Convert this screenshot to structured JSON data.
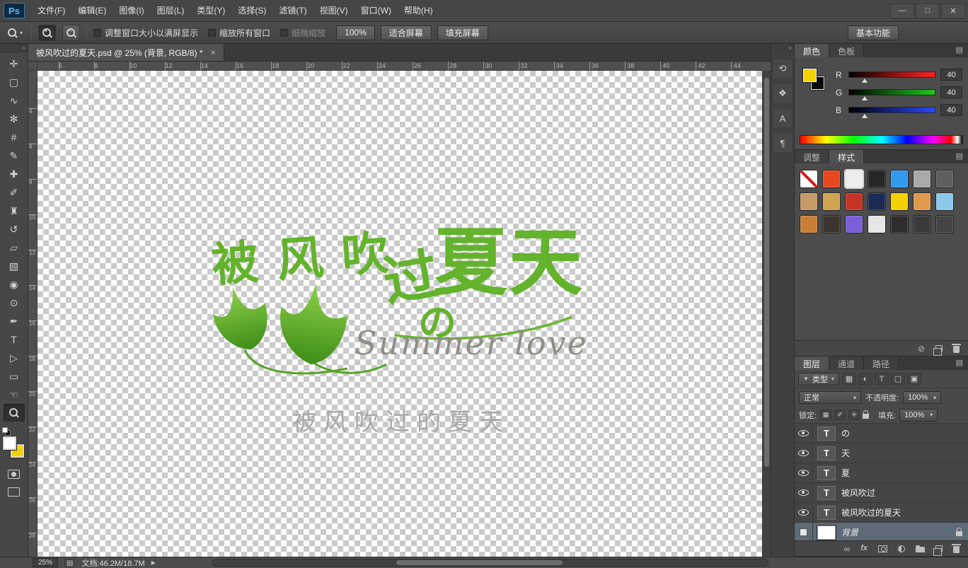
{
  "titlebar": {
    "logo": "Ps",
    "menus": [
      "文件(F)",
      "编辑(E)",
      "图像(I)",
      "图层(L)",
      "类型(Y)",
      "选择(S)",
      "滤镜(T)",
      "视图(V)",
      "窗口(W)",
      "帮助(H)"
    ],
    "window_buttons": [
      {
        "name": "minimize-button",
        "glyph": "—"
      },
      {
        "name": "maximize-button",
        "glyph": "□"
      },
      {
        "name": "close-button",
        "glyph": "✕"
      }
    ]
  },
  "options_bar": {
    "checkboxes": [
      {
        "label": "调整窗口大小以满屏显示",
        "checked": false,
        "disabled": false
      },
      {
        "label": "缩放所有窗口",
        "checked": false,
        "disabled": false
      },
      {
        "label": "细微缩放",
        "checked": false,
        "disabled": true
      }
    ],
    "buttons": [
      "100%",
      "适合屏幕",
      "填充屏幕"
    ],
    "workspace_button": "基本功能"
  },
  "chrome": {
    "collapse_tools": "»",
    "collapse_panels": "«",
    "panel_menu": "▤",
    "tool_preset_dropdown": "▾",
    "status_flyout": "▶",
    "proxy_icon": "▤"
  },
  "document_tab": {
    "title": "被风吹过的夏天.psd @ 25% (背景, RGB/8) *",
    "close": "×"
  },
  "tools": [
    {
      "name": "move-tool",
      "glyph": "✛"
    },
    {
      "name": "rectangular-marquee-tool",
      "glyph": "▢"
    },
    {
      "name": "lasso-tool",
      "glyph": "∿"
    },
    {
      "name": "quick-selection-tool",
      "glyph": "✻"
    },
    {
      "name": "crop-tool",
      "glyph": "#"
    },
    {
      "name": "eyedropper-tool",
      "glyph": "✎"
    },
    {
      "name": "spot-healing-brush-tool",
      "glyph": "✚"
    },
    {
      "name": "brush-tool",
      "glyph": "✐"
    },
    {
      "name": "clone-stamp-tool",
      "glyph": "♜"
    },
    {
      "name": "history-brush-tool",
      "glyph": "↺"
    },
    {
      "name": "eraser-tool",
      "glyph": "▱"
    },
    {
      "name": "gradient-tool",
      "glyph": "▧"
    },
    {
      "name": "blur-tool",
      "glyph": "◉"
    },
    {
      "name": "dodge-tool",
      "glyph": "⊙"
    },
    {
      "name": "pen-tool",
      "glyph": "✒"
    },
    {
      "name": "type-tool",
      "glyph": "T"
    },
    {
      "name": "path-selection-tool",
      "glyph": "▷"
    },
    {
      "name": "rectangle-tool",
      "glyph": "▭"
    },
    {
      "name": "hand-tool",
      "glyph": "☜"
    },
    {
      "name": "zoom-tool",
      "css": "mag",
      "selected": true
    }
  ],
  "ruler": {
    "horizontal": [
      "6",
      "8",
      "10",
      "12",
      "14",
      "16",
      "18",
      "20",
      "22",
      "24",
      "26",
      "28",
      "30",
      "32",
      "34",
      "36",
      "38",
      "40",
      "42",
      "44"
    ],
    "vertical": [
      "4",
      "6",
      "8",
      "10",
      "12",
      "14",
      "16",
      "18",
      "20",
      "22",
      "24",
      "26",
      "28"
    ]
  },
  "artwork": {
    "title_part1": "被风吹",
    "title_part2": "过",
    "title_part3": "夏天",
    "title_part4": "の",
    "subtitle_script": "Summer love",
    "subtitle_gray": "被风吹过的夏天",
    "green": "#63b32c",
    "leaf_dark": "#3e8d18",
    "leaf_light": "#8ed24a",
    "script_gray": "#8f8f86",
    "gray": "#a9a9a9"
  },
  "panel_strip": [
    {
      "name": "history-panel-icon",
      "glyph": "⟲"
    },
    {
      "name": "clone-source-panel-icon",
      "glyph": "❖"
    },
    {
      "name": "character-panel-icon",
      "glyph": "A"
    },
    {
      "name": "paragraph-panel-icon",
      "glyph": "¶"
    }
  ],
  "color_panel": {
    "tabs": [
      "颜色",
      "色板"
    ],
    "active_tab": "颜色",
    "foreground": "#f2d200",
    "background": "#0a0a0a",
    "channels": [
      {
        "label": "R",
        "value": "40",
        "track": "red"
      },
      {
        "label": "G",
        "value": "40",
        "track": "green"
      },
      {
        "label": "B",
        "value": "40",
        "track": "blue"
      }
    ]
  },
  "styles_panel": {
    "tabs": [
      "调整",
      "样式"
    ],
    "active_tab": "样式",
    "swatches": [
      "none",
      "#e8481f",
      "#ededed",
      "#262626",
      "#2f9bf0",
      "#a9a9a9",
      "#5f5f5f",
      "#c59a67",
      "#d2a352",
      "#c63427",
      "#1c2a56",
      "#f3d103",
      "#e09a4e",
      "#8cc8ea",
      "#c87f35",
      "#3c3430",
      "#7a5fd6",
      "#e6e6e6",
      "#2d2d2d",
      "#3a3a3a",
      "#444444"
    ],
    "bottom_icons": [
      {
        "name": "clear-style-icon",
        "glyph": "⊘"
      },
      {
        "name": "new-style-icon",
        "css": "newlayer"
      },
      {
        "name": "delete-style-icon",
        "css": "trash"
      }
    ]
  },
  "layers_panel": {
    "tabs": [
      "图层",
      "通道",
      "路径"
    ],
    "active_tab": "图层",
    "filter_label": "类型",
    "filter_icons": [
      {
        "name": "filter-pixel-layers-icon",
        "glyph": "▦"
      },
      {
        "name": "filter-adjustment-layers-icon",
        "glyph": "◐"
      },
      {
        "name": "filter-type-layers-icon",
        "glyph": "T"
      },
      {
        "name": "filter-shape-layers-icon",
        "glyph": "▢"
      },
      {
        "name": "filter-smart-objects-icon",
        "glyph": "▣"
      }
    ],
    "blend_mode": "正常",
    "opacity_label": "不透明度:",
    "opacity": "100%",
    "lock_label": "锁定:",
    "lock_icons": [
      {
        "name": "lock-transparency-icon",
        "glyph": "▦"
      },
      {
        "name": "lock-pixels-icon",
        "glyph": "✐"
      },
      {
        "name": "lock-position-icon",
        "glyph": "✛"
      },
      {
        "name": "lock-all-icon",
        "css": "lock"
      }
    ],
    "fill_label": "填充:",
    "fill": "100%",
    "layers": [
      {
        "name": "の",
        "type": "text",
        "visible": true
      },
      {
        "name": "天",
        "type": "text",
        "visible": true
      },
      {
        "name": "夏",
        "type": "text",
        "visible": true
      },
      {
        "name": "被风吹过",
        "type": "text",
        "visible": true
      },
      {
        "name": "被风吹过的夏天",
        "type": "text",
        "visible": true
      },
      {
        "name": "背景",
        "type": "background",
        "visible": false,
        "locked": true,
        "selected": true
      }
    ],
    "bottom_icons": [
      {
        "name": "link-layers-icon",
        "glyph": "∞"
      },
      {
        "name": "layer-style-fx-icon",
        "glyph": "fx"
      },
      {
        "name": "add-layer-mask-icon",
        "css": "maskicon"
      },
      {
        "name": "new-adjustment-layer-icon",
        "css": "adjicon"
      },
      {
        "name": "new-group-icon",
        "css": "folder"
      },
      {
        "name": "new-layer-icon",
        "css": "newlayer"
      },
      {
        "name": "delete-layer-icon",
        "css": "trash"
      }
    ]
  },
  "status_bar": {
    "zoom": "25%",
    "doc_info": "文档:46.2M/18.7M"
  }
}
